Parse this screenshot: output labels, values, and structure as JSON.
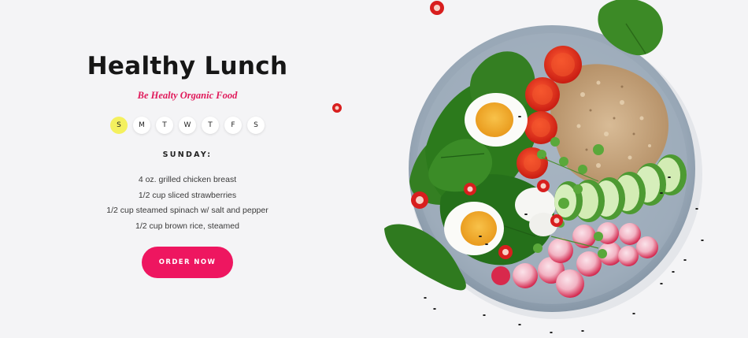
{
  "hero": {
    "title": "Healthy Lunch",
    "subtitle": "Be Healty Organic Food",
    "days": [
      "S",
      "M",
      "T",
      "W",
      "T",
      "F",
      "S"
    ],
    "active_day_index": 0,
    "selected_day_heading": "SUNDAY:",
    "menu_items": [
      "4 oz. grilled chicken breast",
      "1/2 cup sliced strawberries",
      "1/2 cup steamed spinach w/ salt and pepper",
      "1/2 cup brown rice, steamed"
    ],
    "order_button": "ORDER NOW"
  },
  "colors": {
    "background": "#f4f4f6",
    "accent": "#ee1660",
    "subtitle": "#e0195a",
    "active_day": "#f4f05e",
    "plate": "#9eadbd"
  },
  "image": {
    "subject": "bowl-of-healthy-food"
  }
}
